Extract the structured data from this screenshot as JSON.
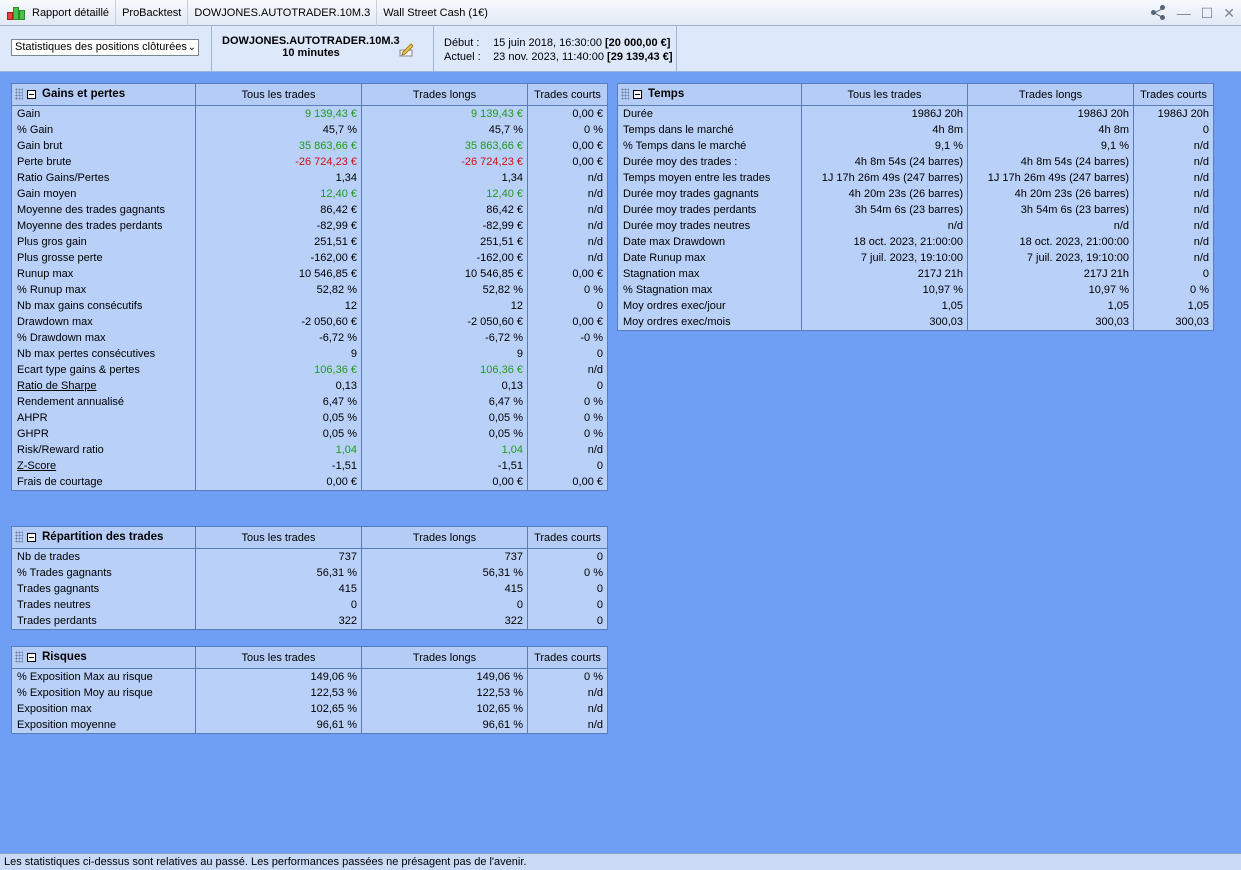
{
  "titlebar": {
    "items": [
      "Rapport détaillé",
      "ProBacktest",
      "DOWJONES.AUTOTRADER.10M.3",
      "Wall Street Cash (1€)"
    ],
    "controls": [
      "share-icon",
      "minimize-icon",
      "maximize-icon",
      "close-icon"
    ]
  },
  "header": {
    "select_value": "Statistiques des positions clôturées",
    "strategy_name": "DOWJONES.AUTOTRADER.10M.3",
    "timeframe": "10 minutes",
    "debut_label": "Début :",
    "debut_value": "15 juin 2018, 16:30:00",
    "debut_capital": "[20 000,00 €]",
    "actuel_label": "Actuel :",
    "actuel_value": "23 nov. 2023, 11:40:00",
    "actuel_capital": "[29 139,43 €]"
  },
  "columns": [
    "Tous les trades",
    "Trades longs",
    "Trades courts"
  ],
  "tables": {
    "gains": {
      "title": "Gains et pertes",
      "rows": [
        {
          "label": "Gain",
          "v": [
            "9 139,43 €",
            "9 139,43 €",
            "0,00 €"
          ],
          "c": [
            "pos",
            "pos",
            ""
          ]
        },
        {
          "label": "% Gain",
          "v": [
            "45,7 %",
            "45,7 %",
            "0 %"
          ],
          "c": [
            "",
            "",
            ""
          ]
        },
        {
          "label": "Gain brut",
          "v": [
            "35 863,66 €",
            "35 863,66 €",
            "0,00 €"
          ],
          "c": [
            "pos",
            "pos",
            ""
          ]
        },
        {
          "label": "Perte brute",
          "v": [
            "-26 724,23 €",
            "-26 724,23 €",
            "0,00 €"
          ],
          "c": [
            "neg",
            "neg",
            ""
          ]
        },
        {
          "label": "Ratio Gains/Pertes",
          "v": [
            "1,34",
            "1,34",
            "n/d"
          ],
          "c": [
            "",
            "",
            ""
          ]
        },
        {
          "label": "Gain moyen",
          "v": [
            "12,40 €",
            "12,40 €",
            "n/d"
          ],
          "c": [
            "pos",
            "pos",
            ""
          ]
        },
        {
          "label": "Moyenne des trades gagnants",
          "v": [
            "86,42 €",
            "86,42 €",
            "n/d"
          ],
          "c": [
            "",
            "",
            ""
          ]
        },
        {
          "label": "Moyenne des trades perdants",
          "v": [
            "-82,99 €",
            "-82,99 €",
            "n/d"
          ],
          "c": [
            "",
            "",
            ""
          ]
        },
        {
          "label": "Plus gros gain",
          "v": [
            "251,51 €",
            "251,51 €",
            "n/d"
          ],
          "c": [
            "",
            "",
            ""
          ]
        },
        {
          "label": "Plus grosse perte",
          "v": [
            "-162,00 €",
            "-162,00 €",
            "n/d"
          ],
          "c": [
            "",
            "",
            ""
          ]
        },
        {
          "label": "Runup max",
          "v": [
            "10 546,85 €",
            "10 546,85 €",
            "0,00 €"
          ],
          "c": [
            "",
            "",
            ""
          ]
        },
        {
          "label": "% Runup max",
          "v": [
            "52,82 %",
            "52,82 %",
            "0 %"
          ],
          "c": [
            "",
            "",
            ""
          ]
        },
        {
          "label": "Nb max gains consécutifs",
          "v": [
            "12",
            "12",
            "0"
          ],
          "c": [
            "",
            "",
            ""
          ]
        },
        {
          "label": "Drawdown max",
          "v": [
            "-2 050,60 €",
            "-2 050,60 €",
            "0,00 €"
          ],
          "c": [
            "",
            "",
            ""
          ]
        },
        {
          "label": "% Drawdown max",
          "v": [
            "-6,72 %",
            "-6,72 %",
            "-0 %"
          ],
          "c": [
            "",
            "",
            ""
          ]
        },
        {
          "label": "Nb max pertes consécutives",
          "v": [
            "9",
            "9",
            "0"
          ],
          "c": [
            "",
            "",
            ""
          ]
        },
        {
          "label": "Ecart type gains & pertes",
          "v": [
            "106,36 €",
            "106,36 €",
            "n/d"
          ],
          "c": [
            "pos",
            "pos",
            ""
          ]
        },
        {
          "label": "Ratio de Sharpe",
          "v": [
            "0,13",
            "0,13",
            "0"
          ],
          "c": [
            "",
            "",
            ""
          ],
          "ul": true
        },
        {
          "label": "Rendement annualisé",
          "v": [
            "6,47 %",
            "6,47 %",
            "0 %"
          ],
          "c": [
            "",
            "",
            ""
          ]
        },
        {
          "label": "AHPR",
          "v": [
            "0,05 %",
            "0,05 %",
            "0 %"
          ],
          "c": [
            "",
            "",
            ""
          ]
        },
        {
          "label": "GHPR",
          "v": [
            "0,05 %",
            "0,05 %",
            "0 %"
          ],
          "c": [
            "",
            "",
            ""
          ]
        },
        {
          "label": "Risk/Reward ratio",
          "v": [
            "1,04",
            "1,04",
            "n/d"
          ],
          "c": [
            "pos",
            "pos",
            ""
          ]
        },
        {
          "label": "Z-Score",
          "v": [
            "-1,51",
            "-1,51",
            "0"
          ],
          "c": [
            "",
            "",
            ""
          ],
          "ul": true
        },
        {
          "label": "Frais de courtage",
          "v": [
            "0,00 €",
            "0,00 €",
            "0,00 €"
          ],
          "c": [
            "",
            "",
            ""
          ]
        }
      ]
    },
    "repartition": {
      "title": "Répartition des trades",
      "rows": [
        {
          "label": "Nb de trades",
          "v": [
            "737",
            "737",
            "0"
          ],
          "c": [
            "",
            "",
            ""
          ]
        },
        {
          "label": "% Trades gagnants",
          "v": [
            "56,31 %",
            "56,31 %",
            "0 %"
          ],
          "c": [
            "",
            "",
            ""
          ]
        },
        {
          "label": "Trades gagnants",
          "v": [
            "415",
            "415",
            "0"
          ],
          "c": [
            "",
            "",
            ""
          ]
        },
        {
          "label": "Trades neutres",
          "v": [
            "0",
            "0",
            "0"
          ],
          "c": [
            "",
            "",
            ""
          ]
        },
        {
          "label": "Trades perdants",
          "v": [
            "322",
            "322",
            "0"
          ],
          "c": [
            "",
            "",
            ""
          ]
        }
      ]
    },
    "risques": {
      "title": "Risques",
      "rows": [
        {
          "label": "% Exposition Max au risque",
          "v": [
            "149,06 %",
            "149,06 %",
            "0 %"
          ],
          "c": [
            "",
            "",
            ""
          ]
        },
        {
          "label": "% Exposition Moy au risque",
          "v": [
            "122,53 %",
            "122,53 %",
            "n/d"
          ],
          "c": [
            "",
            "",
            ""
          ]
        },
        {
          "label": "Exposition max",
          "v": [
            "102,65 %",
            "102,65 %",
            "n/d"
          ],
          "c": [
            "",
            "",
            ""
          ]
        },
        {
          "label": "Exposition moyenne",
          "v": [
            "96,61 %",
            "96,61 %",
            "n/d"
          ],
          "c": [
            "",
            "",
            ""
          ]
        }
      ]
    },
    "temps": {
      "title": "Temps",
      "rows": [
        {
          "label": "Durée",
          "v": [
            "1986J 20h",
            "1986J 20h",
            "1986J 20h"
          ],
          "c": [
            "",
            "",
            ""
          ]
        },
        {
          "label": "Temps dans le marché",
          "v": [
            "4h 8m",
            "4h 8m",
            "0"
          ],
          "c": [
            "",
            "",
            ""
          ]
        },
        {
          "label": "% Temps dans le marché",
          "v": [
            "9,1 %",
            "9,1 %",
            "n/d"
          ],
          "c": [
            "",
            "",
            ""
          ]
        },
        {
          "label": "Durée moy des trades :",
          "v": [
            "4h 8m 54s (24 barres)",
            "4h 8m 54s (24 barres)",
            "n/d"
          ],
          "c": [
            "",
            "",
            ""
          ]
        },
        {
          "label": "Temps moyen entre les trades",
          "v": [
            "1J 17h 26m 49s (247 barres)",
            "1J 17h 26m 49s (247 barres)",
            "n/d"
          ],
          "c": [
            "",
            "",
            ""
          ]
        },
        {
          "label": "Durée moy trades gagnants",
          "v": [
            "4h 20m 23s (26 barres)",
            "4h 20m 23s (26 barres)",
            "n/d"
          ],
          "c": [
            "",
            "",
            ""
          ]
        },
        {
          "label": "Durée moy trades perdants",
          "v": [
            "3h 54m 6s (23 barres)",
            "3h 54m 6s (23 barres)",
            "n/d"
          ],
          "c": [
            "",
            "",
            ""
          ]
        },
        {
          "label": "Durée moy trades neutres",
          "v": [
            "n/d",
            "n/d",
            "n/d"
          ],
          "c": [
            "",
            "",
            ""
          ]
        },
        {
          "label": "Date max Drawdown",
          "v": [
            "18 oct. 2023, 21:00:00",
            "18 oct. 2023, 21:00:00",
            "n/d"
          ],
          "c": [
            "",
            "",
            ""
          ]
        },
        {
          "label": "Date Runup max",
          "v": [
            "7 juil. 2023, 19:10:00",
            "7 juil. 2023, 19:10:00",
            "n/d"
          ],
          "c": [
            "",
            "",
            ""
          ]
        },
        {
          "label": "Stagnation max",
          "v": [
            "217J 21h",
            "217J 21h",
            "0"
          ],
          "c": [
            "",
            "",
            ""
          ]
        },
        {
          "label": "% Stagnation max",
          "v": [
            "10,97 %",
            "10,97 %",
            "0 %"
          ],
          "c": [
            "",
            "",
            ""
          ]
        },
        {
          "label": "Moy ordres exec/jour",
          "v": [
            "1,05",
            "1,05",
            "1,05"
          ],
          "c": [
            "",
            "",
            ""
          ]
        },
        {
          "label": "Moy ordres exec/mois",
          "v": [
            "300,03",
            "300,03",
            "300,03"
          ],
          "c": [
            "",
            "",
            ""
          ]
        }
      ]
    }
  },
  "footer": "Les statistiques ci-dessus sont relatives au passé. Les performances passées ne présagent pas de l'avenir."
}
